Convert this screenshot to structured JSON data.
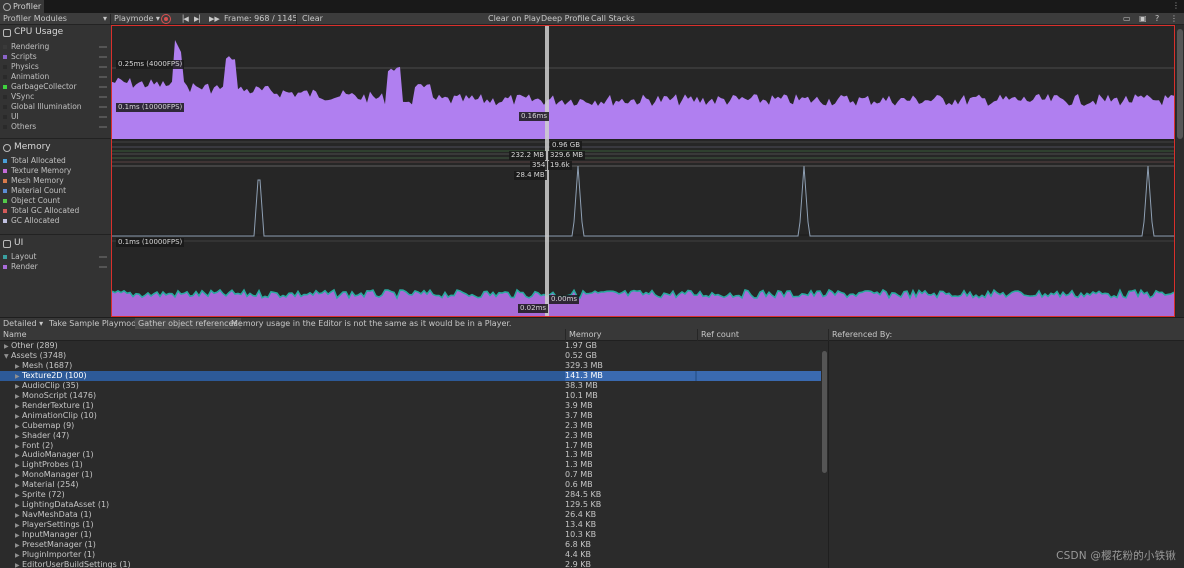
{
  "window": {
    "tab_title": "Profiler",
    "tab_icon": "profiler-icon"
  },
  "toolbar": {
    "modules_label": "Profiler Modules",
    "playmode_label": "Playmode",
    "frame_label": "Frame: 968 / 1145",
    "clear_label": "Clear",
    "clear_on_play_label": "Clear on Play",
    "deep_profile_label": "Deep Profile",
    "call_stacks_label": "Call Stacks",
    "record_icon": "record-icon",
    "prev_frame_icon": "step-back-icon",
    "next_frame_icon": "step-forward-icon",
    "last_frame_icon": "skip-to-end-icon",
    "load_icon": "folder-open-icon",
    "save_icon": "save-icon",
    "help_icon": "help-icon",
    "more_icon": "kebab-icon"
  },
  "modules": {
    "cpu": {
      "title": "CPU Usage",
      "legend": [
        {
          "label": "Rendering",
          "color": "#3a3a3a"
        },
        {
          "label": "Scripts",
          "color": "#8a64c8"
        },
        {
          "label": "Physics",
          "color": "#2a2a2a"
        },
        {
          "label": "Animation",
          "color": "#2a2a2a"
        },
        {
          "label": "GarbageCollector",
          "color": "#3ed13e"
        },
        {
          "label": "VSync",
          "color": "#2a2a2a"
        },
        {
          "label": "Global Illumination",
          "color": "#2a2a2a"
        },
        {
          "label": "UI",
          "color": "#2a2a2a"
        },
        {
          "label": "Others",
          "color": "#2a2a2a"
        }
      ],
      "labels": {
        "upper": "0.25ms (4000FPS)",
        "lower": "0.1ms (10000FPS)",
        "cursor": "0.16ms"
      }
    },
    "memory": {
      "title": "Memory",
      "legend": [
        {
          "label": "Total Allocated",
          "color": "#4aa0d8"
        },
        {
          "label": "Texture Memory",
          "color": "#c46bd8"
        },
        {
          "label": "Mesh Memory",
          "color": "#d97a4a"
        },
        {
          "label": "Material Count",
          "color": "#5b8ed6"
        },
        {
          "label": "Object Count",
          "color": "#53c94a"
        },
        {
          "label": "Total GC Allocated",
          "color": "#d35a5a"
        },
        {
          "label": "GC Allocated",
          "color": "#c0c0e0"
        }
      ],
      "labels": {
        "total": "0.96 GB",
        "left1": "232.2 MB",
        "right1": "329.6 MB",
        "mid": "354",
        "right2": "19.6k",
        "left2": "28.4 MB"
      }
    },
    "ui": {
      "title": "UI",
      "legend": [
        {
          "label": "Layout",
          "color": "#3aa0a0"
        },
        {
          "label": "Render",
          "color": "#a86bd8"
        }
      ],
      "labels": {
        "upper": "0.1ms (10000FPS)",
        "cursor_right": "0.00ms",
        "cursor_bottom": "0.02ms"
      }
    }
  },
  "bottom_toolbar": {
    "view_label": "Detailed",
    "take_sample_label": "Take Sample Playmode",
    "gather_label": "Gather object references",
    "notice": "Memory usage in the Editor is not the same as it would be in a Player."
  },
  "table": {
    "columns": {
      "name": "Name",
      "memory": "Memory",
      "ref_count": "Ref count",
      "referenced_by": "Referenced By:"
    },
    "rows": [
      {
        "name": "Other (289)",
        "memory": "1.97 GB",
        "depth": 0,
        "expanded": false
      },
      {
        "name": "Assets (3748)",
        "memory": "0.52 GB",
        "depth": 0,
        "expanded": true
      },
      {
        "name": "Mesh (1687)",
        "memory": "329.3 MB",
        "depth": 1,
        "expanded": false
      },
      {
        "name": "Texture2D (100)",
        "memory": "141.3 MB",
        "depth": 1,
        "expanded": false
      },
      {
        "name": "AudioClip (35)",
        "memory": "38.3 MB",
        "depth": 1,
        "expanded": false
      },
      {
        "name": "MonoScript (1476)",
        "memory": "10.1 MB",
        "depth": 1,
        "expanded": false
      },
      {
        "name": "RenderTexture (1)",
        "memory": "3.9 MB",
        "depth": 1,
        "expanded": false
      },
      {
        "name": "AnimationClip (10)",
        "memory": "3.7 MB",
        "depth": 1,
        "expanded": false
      },
      {
        "name": "Cubemap (9)",
        "memory": "2.3 MB",
        "depth": 1,
        "expanded": false
      },
      {
        "name": "Shader (47)",
        "memory": "2.3 MB",
        "depth": 1,
        "expanded": false
      },
      {
        "name": "Font (2)",
        "memory": "1.7 MB",
        "depth": 1,
        "expanded": false
      },
      {
        "name": "AudioManager (1)",
        "memory": "1.3 MB",
        "depth": 1,
        "expanded": false
      },
      {
        "name": "LightProbes (1)",
        "memory": "1.3 MB",
        "depth": 1,
        "expanded": false
      },
      {
        "name": "MonoManager (1)",
        "memory": "0.7 MB",
        "depth": 1,
        "expanded": false
      },
      {
        "name": "Material (254)",
        "memory": "0.6 MB",
        "depth": 1,
        "expanded": false
      },
      {
        "name": "Sprite (72)",
        "memory": "284.5 KB",
        "depth": 1,
        "expanded": false
      },
      {
        "name": "LightingDataAsset (1)",
        "memory": "129.5 KB",
        "depth": 1,
        "expanded": false
      },
      {
        "name": "NavMeshData (1)",
        "memory": "26.4 KB",
        "depth": 1,
        "expanded": false
      },
      {
        "name": "PlayerSettings (1)",
        "memory": "13.4 KB",
        "depth": 1,
        "expanded": false
      },
      {
        "name": "InputManager (1)",
        "memory": "10.3 KB",
        "depth": 1,
        "expanded": false
      },
      {
        "name": "PresetManager (1)",
        "memory": "6.8 KB",
        "depth": 1,
        "expanded": false
      },
      {
        "name": "PluginImporter (1)",
        "memory": "4.4 KB",
        "depth": 1,
        "expanded": false
      },
      {
        "name": "EditorUserBuildSettings (1)",
        "memory": "2.9 KB",
        "depth": 1,
        "expanded": false
      }
    ],
    "selected_name": "Texture2D (100)"
  },
  "watermark": "CSDN @樱花粉的小铁锹",
  "colors": {
    "accent_red": "#d9302c",
    "cpu_fill": "#b07ff0",
    "ui_fill": "#a86bd8",
    "ui_edge": "#2aa9a0",
    "selection": "#2d5a98"
  }
}
